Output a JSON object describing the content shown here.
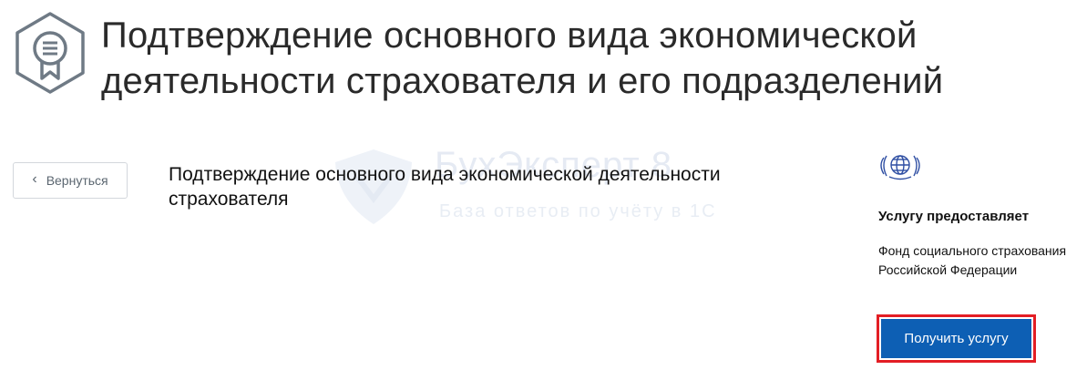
{
  "header": {
    "title": "Подтверждение основного вида экономической деятельности страхователя и его подразделений",
    "icon": "certificate-badge-icon"
  },
  "watermark": {
    "title": "БухЭксперт 8",
    "subtitle": "База ответов по учёту в 1С"
  },
  "navigation": {
    "back_label": "Вернуться",
    "back_icon": "chevron-left-icon"
  },
  "main": {
    "service_name": "Подтверждение основного вида экономической деятельности страхователя"
  },
  "provider": {
    "logo": "fss-emblem-icon",
    "heading": "Услугу предоставляет",
    "name": "Фонд социального страхования Российской Федерации"
  },
  "actions": {
    "get_service_label": "Получить услугу"
  },
  "colors": {
    "accent_blue": "#0d5fb4",
    "highlight_red": "#e31e24",
    "icon_gray": "#6b7580"
  }
}
